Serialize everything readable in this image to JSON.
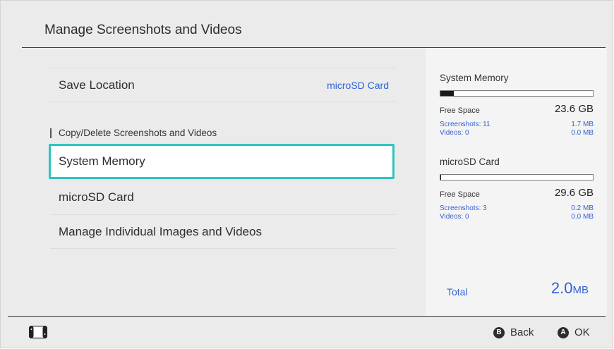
{
  "header": {
    "title": "Manage Screenshots and Videos"
  },
  "list": {
    "save_location": {
      "label": "Save Location",
      "value": "microSD Card"
    },
    "section_heading": "Copy/Delete Screenshots and Videos",
    "items": [
      {
        "label": "System Memory"
      },
      {
        "label": "microSD Card"
      },
      {
        "label": "Manage Individual Images and Videos"
      }
    ]
  },
  "panel": {
    "system_memory": {
      "title": "System Memory",
      "usage_fraction": 0.09,
      "free_label": "Free Space",
      "free_value": "23.6 GB",
      "screenshots_label": "Screenshots: 11",
      "screenshots_value": "1.7 MB",
      "videos_label": "Videos: 0",
      "videos_value": "0.0 MB"
    },
    "microsd": {
      "title": "microSD Card",
      "usage_fraction": 0.005,
      "free_label": "Free Space",
      "free_value": "29.6 GB",
      "screenshots_label": "Screenshots: 3",
      "screenshots_value": "0.2 MB",
      "videos_label": "Videos: 0",
      "videos_value": "0.0 MB"
    },
    "total_label": "Total",
    "total_number": "2.0",
    "total_unit": "MB"
  },
  "footer": {
    "back_glyph": "B",
    "back_label": "Back",
    "ok_glyph": "A",
    "ok_label": "OK"
  },
  "colors": {
    "accent": "#2ec4c4",
    "link": "#3461d4"
  },
  "icons": {
    "console": "console-icon"
  }
}
